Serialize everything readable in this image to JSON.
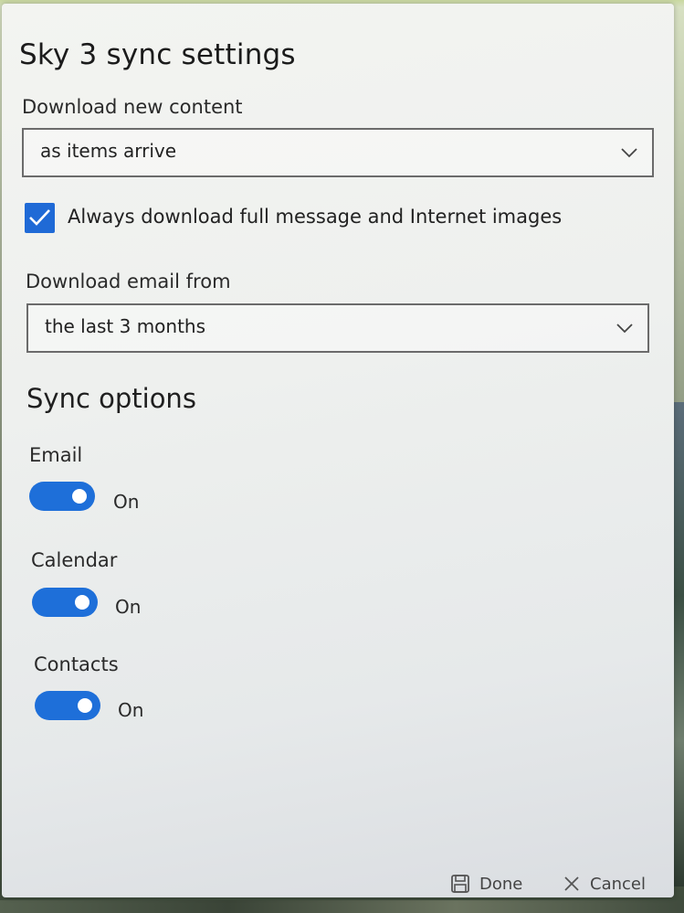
{
  "dialog": {
    "title": "Sky 3 sync settings"
  },
  "download_content": {
    "label": "Download new content",
    "selected": "as items arrive"
  },
  "full_message": {
    "checked": true,
    "label": "Always download full message and Internet images"
  },
  "download_from": {
    "label": "Download email from",
    "selected": "the last 3 months"
  },
  "sync_options": {
    "title": "Sync options",
    "items": [
      {
        "label": "Email",
        "state": "On"
      },
      {
        "label": "Calendar",
        "state": "On"
      },
      {
        "label": "Contacts",
        "state": "On"
      }
    ]
  },
  "footer": {
    "done_label": "Done",
    "done_icon": "save-icon",
    "cancel_label": "Cancel",
    "cancel_icon": "close-icon"
  },
  "colors": {
    "accent": "#1e6fd9"
  }
}
